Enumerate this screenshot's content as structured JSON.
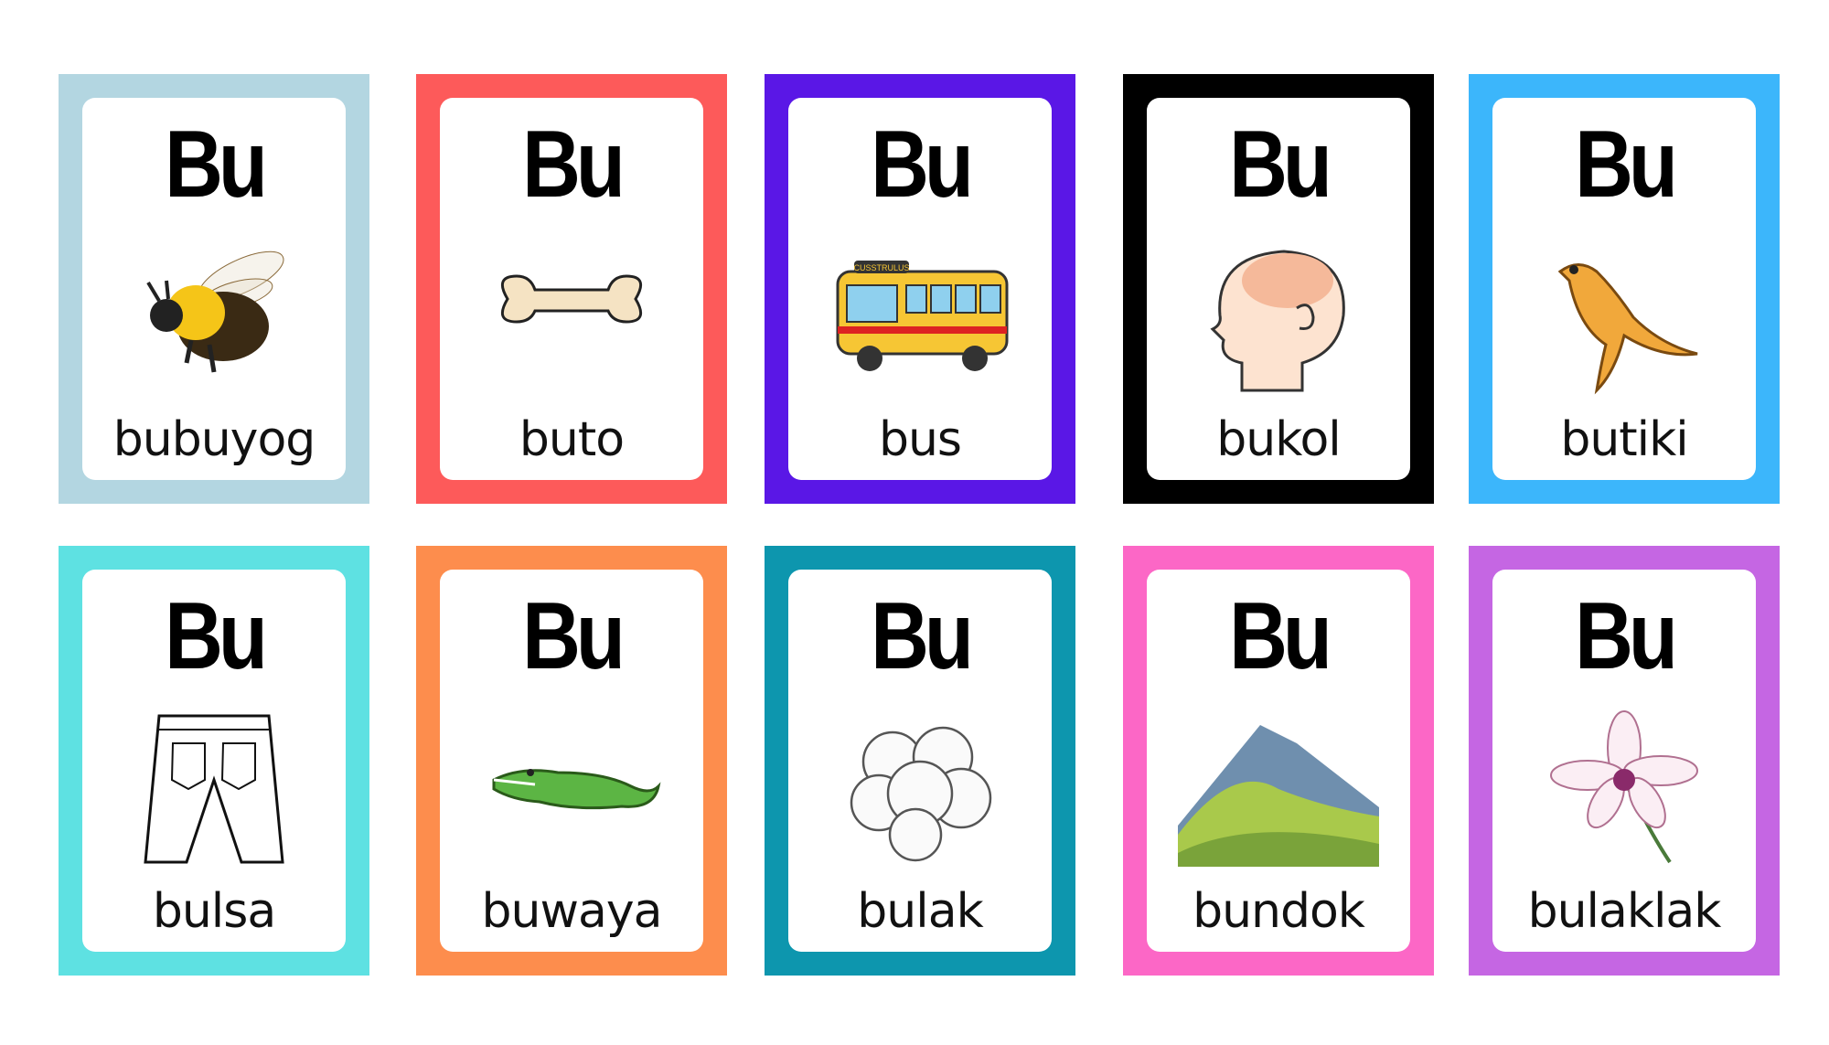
{
  "cards": [
    {
      "syllable": "Bu",
      "word": "bubuyog",
      "picture": "bee",
      "border": "#b3d6e1"
    },
    {
      "syllable": "Bu",
      "word": "buto",
      "picture": "bone",
      "border": "#fd5a5a"
    },
    {
      "syllable": "Bu",
      "word": "bus",
      "picture": "bus",
      "border": "#5a17e6",
      "bus_sign": "CUSSTRULUS"
    },
    {
      "syllable": "Bu",
      "word": "bukol",
      "picture": "head-bump",
      "border": "#000000"
    },
    {
      "syllable": "Bu",
      "word": "butiki",
      "picture": "lizard",
      "border": "#3cb6fb"
    },
    {
      "syllable": "Bu",
      "word": "bulsa",
      "picture": "pants-pocket",
      "border": "#5ee1e2"
    },
    {
      "syllable": "Bu",
      "word": "buwaya",
      "picture": "crocodile",
      "border": "#fd8d4d"
    },
    {
      "syllable": "Bu",
      "word": "bulak",
      "picture": "cotton",
      "border": "#0d96ae"
    },
    {
      "syllable": "Bu",
      "word": "bundok",
      "picture": "mountain",
      "border": "#fc67c6"
    },
    {
      "syllable": "Bu",
      "word": "bulaklak",
      "picture": "flower",
      "border": "#c566e3"
    }
  ]
}
